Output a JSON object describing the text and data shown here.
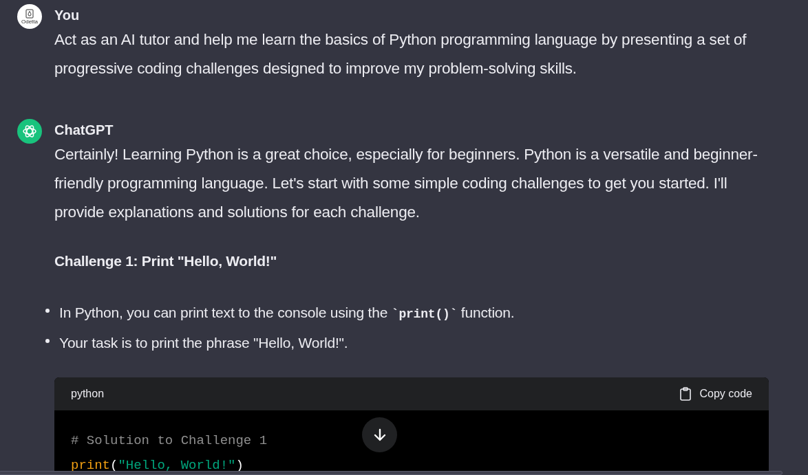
{
  "messages": [
    {
      "kind": "user",
      "author": "You",
      "avatar_text": "Odetta",
      "paragraphs": [
        "Act as an AI tutor and help me learn the basics of Python programming language by presenting a set of progressive coding challenges designed to improve my problem-solving skills."
      ]
    },
    {
      "kind": "assistant",
      "author": "ChatGPT",
      "paragraphs": [
        "Certainly! Learning Python is a great choice, especially for beginners. Python is a versatile and beginner-friendly programming language. Let's start with some simple coding challenges to get you started. I'll provide explanations and solutions for each challenge."
      ],
      "heading": "Challenge 1: Print \"Hello, World!\"",
      "bullets": [
        [
          {
            "kind": "text",
            "text": "In Python, you can print text to the console using the "
          },
          {
            "kind": "code",
            "text": "`print()`"
          },
          {
            "kind": "text",
            "text": " function."
          }
        ],
        [
          {
            "kind": "text",
            "text": "Your task is to print the phrase \"Hello, World!\"."
          }
        ]
      ],
      "code_block": {
        "language": "python",
        "copy_label": "Copy code",
        "lines": [
          [
            {
              "kind": "comment",
              "text": "# Solution to Challenge 1"
            }
          ],
          [
            {
              "kind": "builtin",
              "text": "print"
            },
            {
              "kind": "plain",
              "text": "("
            },
            {
              "kind": "string",
              "text": "\"Hello, World!\""
            },
            {
              "kind": "plain",
              "text": ")"
            }
          ]
        ]
      }
    }
  ]
}
